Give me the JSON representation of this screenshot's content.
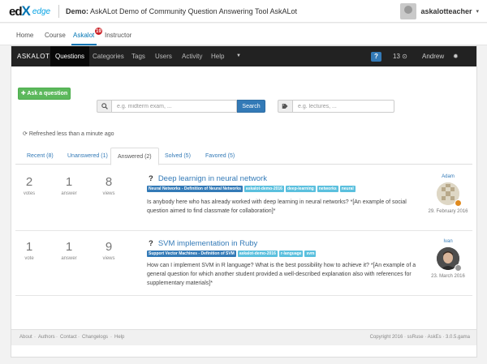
{
  "header": {
    "logo_ed": "ed",
    "logo_x": "X",
    "logo_edge": "edge",
    "course_prefix": "Demo:",
    "course_title": "AskALot Demo of Community Question Answering Tool AskALot",
    "username": "askalotteacher"
  },
  "course_tabs": [
    {
      "label": "Home"
    },
    {
      "label": "Course"
    },
    {
      "label": "Askalot"
    },
    {
      "label": "Instructor"
    }
  ],
  "notification_count": "19",
  "navbar": {
    "brand": "ASKALOT",
    "items": [
      "Questions",
      "Categories",
      "Tags",
      "Users",
      "Activity",
      "Help"
    ],
    "help_icon": "?",
    "score": "13",
    "user": "Andrew",
    "colors": {
      "navbar": "#222222",
      "accent": "#337ab7",
      "success": "#5cb85c"
    }
  },
  "ask_button": "Ask a question",
  "search": {
    "placeholder": "e.g. midterm exam, ...",
    "button": "Search",
    "tags_placeholder": "e.g. lectures, ..."
  },
  "refreshed": "Refreshed less than a minute ago",
  "status_tabs": [
    {
      "label": "Recent (8)"
    },
    {
      "label": "Unanswered (1)"
    },
    {
      "label": "Answered (2)"
    },
    {
      "label": "Solved (5)"
    },
    {
      "label": "Favored (5)"
    }
  ],
  "questions": [
    {
      "votes": "2",
      "votes_label": "votes",
      "answers": "1",
      "answers_label": "answer",
      "views": "8",
      "views_label": "views",
      "title": "Deep learnign in neural network",
      "tags": [
        "Neural Networks - Definition of Neural Networks",
        "askalot-demo-2016",
        "deep-learning",
        "networks",
        "neural"
      ],
      "excerpt": "Is anybody here who has already worked with deep learning in neural networks? *[An example of social question aimed to find classmate for collaboration]*",
      "author": "Adam",
      "date": "29. February 2016"
    },
    {
      "votes": "1",
      "votes_label": "vote",
      "answers": "1",
      "answers_label": "answer",
      "views": "9",
      "views_label": "views",
      "title": "SVM implementation in Ruby",
      "tags": [
        "Support Vector Machines - Definition of SVM",
        "askalot-demo-2016",
        "r-language",
        "svm"
      ],
      "excerpt": "How can I implement SVM in R language? What is the best possibility how to achieve it? *[An example of a general question for which another student provided a well-described explanation also with references for supplementary materials]*",
      "author": "Ivan",
      "date": "23. March 2016"
    }
  ],
  "footer": {
    "links": [
      "About",
      "Authors",
      "Contact",
      "Changelogs",
      "Help"
    ],
    "right": "Copyright 2016 · ssRuse · AskEs · 3.0.5.gama"
  }
}
